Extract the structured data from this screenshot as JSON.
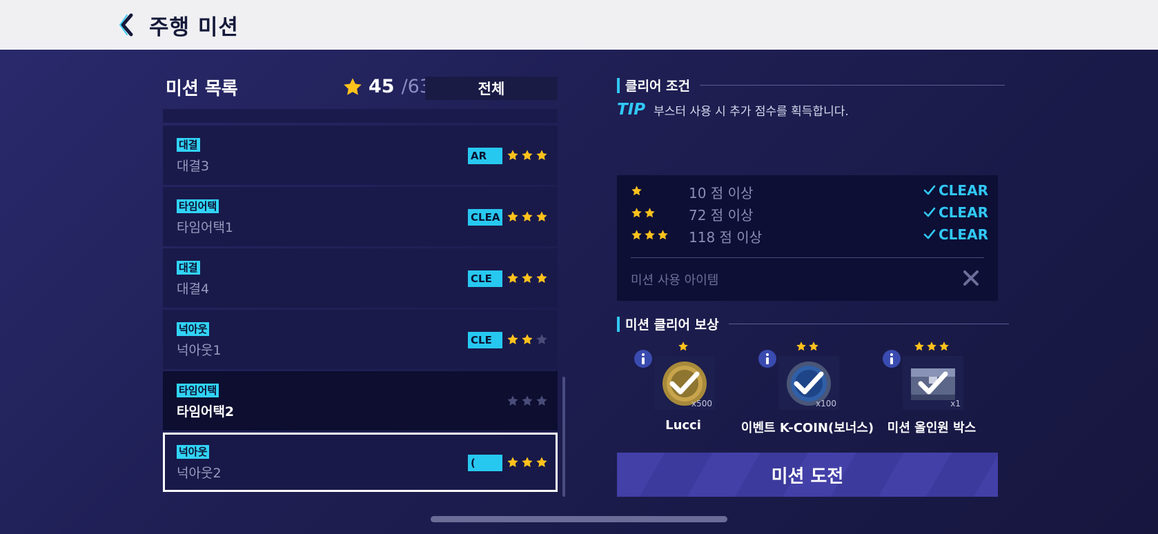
{
  "header": {
    "title": "주행 미션"
  },
  "mission_list": {
    "title": "미션 목록",
    "star_count": "45",
    "star_max": "/63",
    "filter_label": "전체",
    "items": [
      {
        "tag": "대결",
        "name": "대결3",
        "badge": "AR",
        "stars": 3,
        "style": "normal"
      },
      {
        "tag": "타임어택",
        "name": "타임어택1",
        "badge": "CLEA",
        "stars": 3,
        "style": "normal"
      },
      {
        "tag": "대결",
        "name": "대결4",
        "badge": "CLE",
        "stars": 3,
        "style": "normal"
      },
      {
        "tag": "넉아웃",
        "name": "넉아웃1",
        "badge": "CLE",
        "stars": 2,
        "style": "normal"
      },
      {
        "tag": "타임어택",
        "name": "타임어택2",
        "badge": "",
        "stars": 0,
        "style": "dark"
      },
      {
        "tag": "넉아웃",
        "name": "넉아웃2",
        "badge": "(",
        "stars": 3,
        "style": "selected"
      }
    ]
  },
  "clear_conditions": {
    "title": "클리어 조건",
    "tip_label": "TIP",
    "tip_text": "부스터 사용 시 추가 점수를 획득합니다.",
    "rows": [
      {
        "stars": 1,
        "text": "10 점 이상",
        "status": "CLEAR"
      },
      {
        "stars": 2,
        "text": "72 점 이상",
        "status": "CLEAR"
      },
      {
        "stars": 3,
        "text": "118 점 이상",
        "status": "CLEAR"
      }
    ],
    "item_label": "미션 사용 아이템"
  },
  "rewards": {
    "title": "미션 클리어 보상",
    "items": [
      {
        "stars": 1,
        "name": "Lucci",
        "qty": "x500",
        "icon": "gold-coin-icon"
      },
      {
        "stars": 2,
        "name": "이벤트 K-COIN(보너스)",
        "qty": "x100",
        "icon": "k-coin-icon"
      },
      {
        "stars": 3,
        "name": "미션 올인원 박스",
        "qty": "x1",
        "icon": "treasure-box-icon"
      }
    ]
  },
  "challenge_button": "미션 도전",
  "colors": {
    "accent": "#31c8f5",
    "star": "#ffc21c",
    "star_empty": "#4a4c78",
    "button": "#4340a8"
  }
}
